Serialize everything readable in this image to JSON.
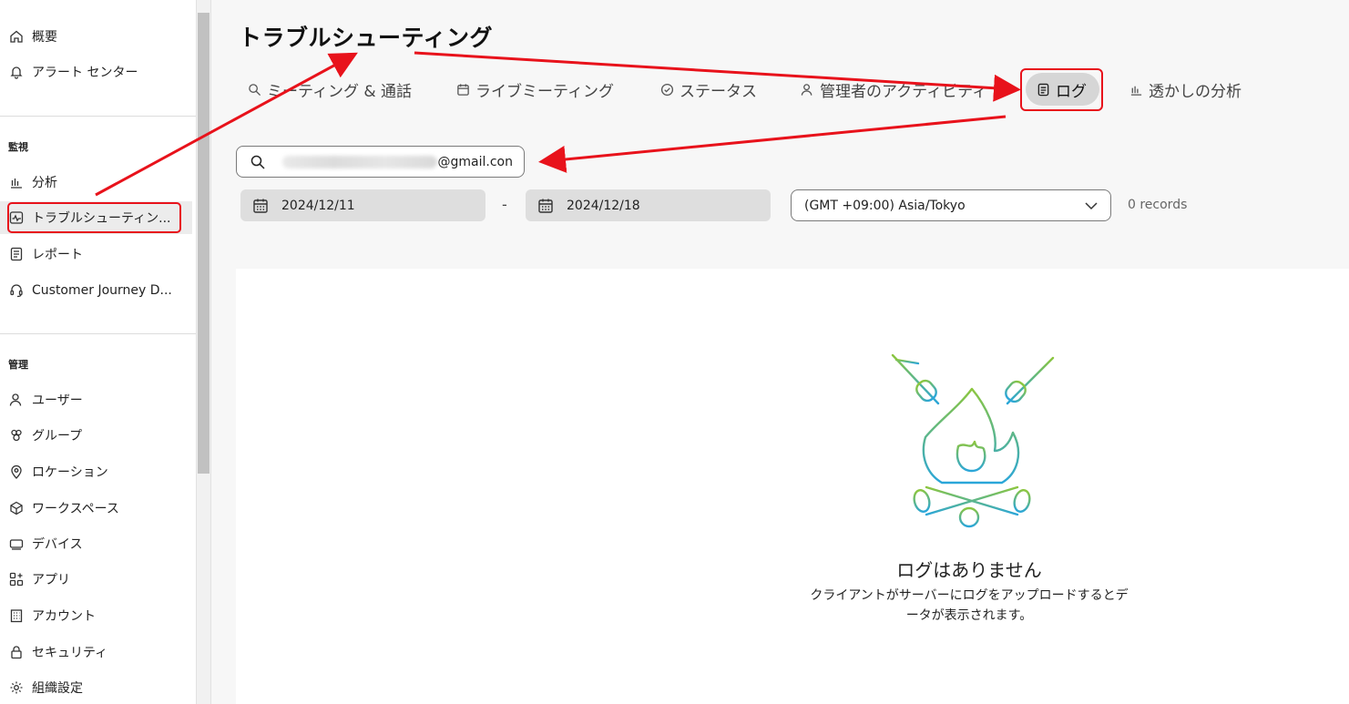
{
  "sidebar": {
    "items_top": [
      {
        "label": "概要",
        "icon": "home-icon"
      },
      {
        "label": "アラート センター",
        "icon": "bell-icon"
      }
    ],
    "section_monitor": "監視",
    "items_monitor": [
      {
        "label": "分析",
        "icon": "bar-chart-icon"
      },
      {
        "label": "トラブルシューティン...",
        "icon": "pulse-icon"
      },
      {
        "label": "レポート",
        "icon": "report-icon"
      },
      {
        "label": "Customer Journey D...",
        "icon": "headset-icon"
      }
    ],
    "section_manage": "管理",
    "items_manage": [
      {
        "label": "ユーザー",
        "icon": "user-icon"
      },
      {
        "label": "グループ",
        "icon": "group-icon"
      },
      {
        "label": "ロケーション",
        "icon": "location-pin-icon"
      },
      {
        "label": "ワークスペース",
        "icon": "workspace-icon"
      },
      {
        "label": "デバイス",
        "icon": "device-icon"
      },
      {
        "label": "アプリ",
        "icon": "apps-icon"
      },
      {
        "label": "アカウント",
        "icon": "building-icon"
      },
      {
        "label": "セキュリティ",
        "icon": "lock-icon"
      },
      {
        "label": "組織設定",
        "icon": "gear-icon"
      }
    ]
  },
  "page": {
    "title": "トラブルシューティング"
  },
  "tabs": [
    {
      "label": "ミーティング & 通話",
      "icon": "search-icon"
    },
    {
      "label": "ライブミーティング",
      "icon": "calendar-icon"
    },
    {
      "label": "ステータス",
      "icon": "check-circle-icon"
    },
    {
      "label": "管理者のアクティビティ",
      "icon": "user-icon"
    },
    {
      "label": "ログ",
      "icon": "document-icon",
      "active": true
    },
    {
      "label": "透かしの分析",
      "icon": "bar-chart-icon"
    }
  ],
  "filters": {
    "search_value_suffix": "@gmail.con",
    "start_date": "2024/12/11",
    "date_separator": "-",
    "end_date": "2024/12/18",
    "timezone": "(GMT +09:00) Asia/Tokyo",
    "records": "0 records"
  },
  "empty_state": {
    "title": "ログはありません",
    "description_line1": "クライアントがサーバーにログをアップロードするとデ",
    "description_line2": "ータが表示されます。"
  },
  "colors": {
    "annotation_red": "#e8121b",
    "art_green": "#8cc63f",
    "art_blue": "#2aa6d9"
  }
}
